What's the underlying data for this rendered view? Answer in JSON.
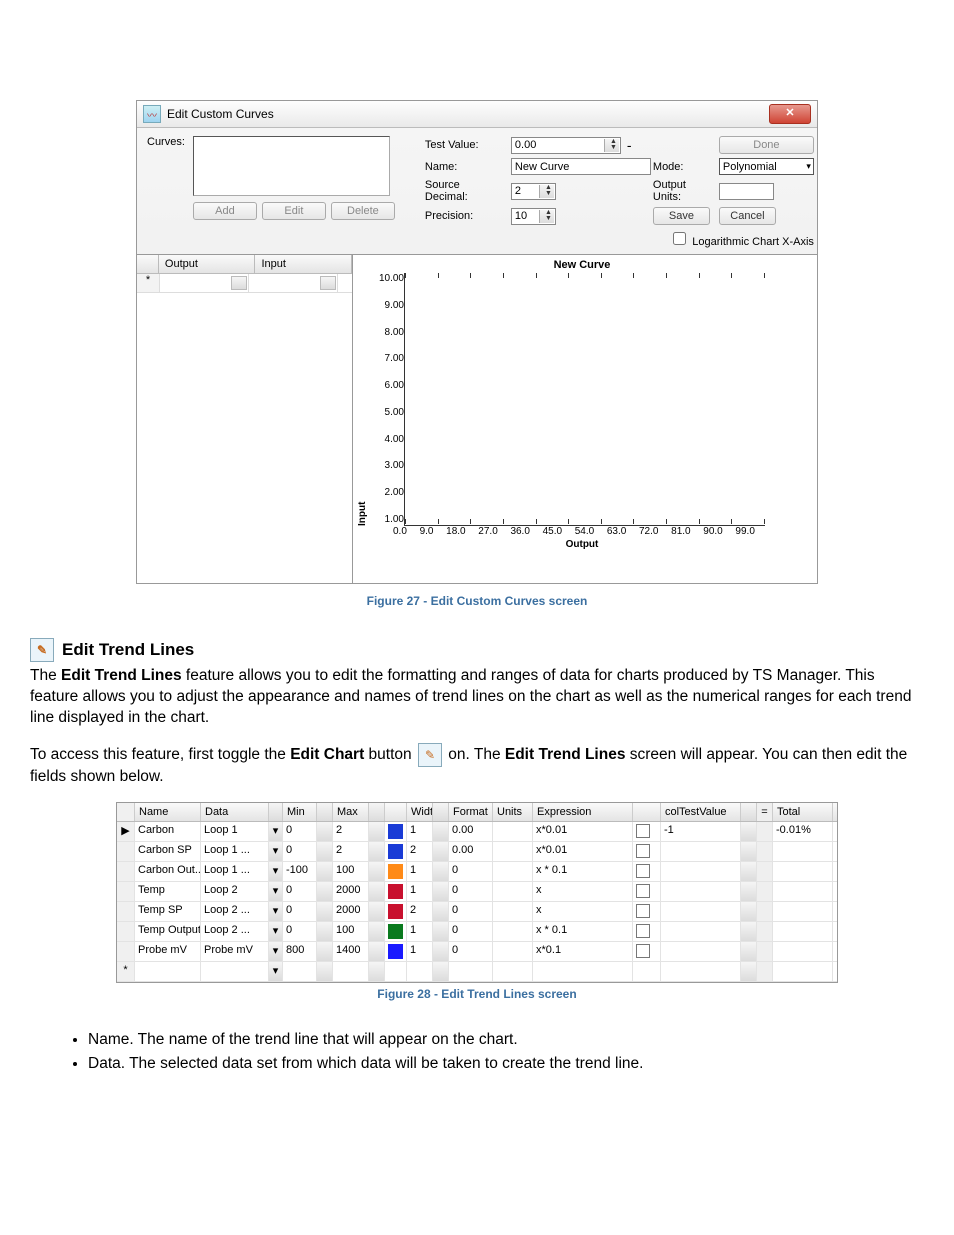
{
  "window": {
    "title": "Edit Custom Curves",
    "close": "✕",
    "labels": {
      "curves": "Curves:",
      "add": "Add",
      "edit": "Edit",
      "delete": "Delete",
      "testValue": "Test Value:",
      "testValueVal": "0.00",
      "done": "Done",
      "name": "Name:",
      "nameVal": "New Curve",
      "mode": "Mode:",
      "modeVal": "Polynomial",
      "sourceDecimal": "Source Decimal:",
      "sourceDecimalVal": "2",
      "outputUnits": "Output Units:",
      "precision": "Precision:",
      "precisionVal": "10",
      "save": "Save",
      "cancel": "Cancel",
      "logx": "Logarithmic Chart X-Axis"
    },
    "gridHeaders": {
      "output": "Output",
      "input": "Input"
    }
  },
  "chart_data": {
    "type": "line",
    "title": "New Curve",
    "xlabel": "Output",
    "ylabel": "Input",
    "xlim": [
      0.0,
      99.0
    ],
    "ylim": [
      1.0,
      10.0
    ],
    "yticks": [
      "10.00",
      "9.00",
      "8.00",
      "7.00",
      "6.00",
      "5.00",
      "4.00",
      "3.00",
      "2.00",
      "1.00"
    ],
    "xticks": [
      "0.0",
      "9.0",
      "18.0",
      "27.0",
      "36.0",
      "45.0",
      "54.0",
      "63.0",
      "72.0",
      "81.0",
      "90.0",
      "99.0"
    ],
    "series": []
  },
  "captions": {
    "fig27": "Figure 27 - Edit Custom Curves screen",
    "fig28": "Figure 28 - Edit Trend Lines screen"
  },
  "section": {
    "heading": "Edit Trend Lines",
    "para1a": "The ",
    "para1b": "Edit Trend Lines",
    "para1c": " feature allows you to edit the formatting and ranges of data for charts produced by TS Manager. This feature allows you to adjust the appearance and names of trend lines on the chart as well as the numerical ranges for each trend line displayed in the chart.",
    "para2a": "To access this feature, first toggle the ",
    "para2b": "Edit Chart",
    "para2c": " button ",
    "para2d": " on. The ",
    "para2e": "Edit Trend Lines",
    "para2f": " screen will appear. You can then edit the fields shown below."
  },
  "trend": {
    "headers": [
      "",
      "Name",
      "Data",
      "",
      "Min",
      "",
      "Max",
      "",
      "",
      "Width",
      "",
      "Format",
      "Units",
      "Expression",
      "",
      "colTestValue",
      "",
      "=",
      "Total"
    ],
    "rows": [
      {
        "name": "Carbon",
        "data": "Loop 1",
        "min": "0",
        "max": "2",
        "color": "#1a3bd6",
        "width": "1",
        "format": "0.00",
        "units": "",
        "expr": "x*0.01",
        "tv": "-1",
        "total": "-0.01%"
      },
      {
        "name": "Carbon SP",
        "data": "Loop 1 ...",
        "min": "0",
        "max": "2",
        "color": "#1a3bd6",
        "width": "2",
        "format": "0.00",
        "units": "",
        "expr": "x*0.01",
        "tv": "",
        "total": ""
      },
      {
        "name": "Carbon Out...",
        "data": "Loop 1 ...",
        "min": "-100",
        "max": "100",
        "color": "#ff8a17",
        "width": "1",
        "format": "0",
        "units": "",
        "expr": "x * 0.1",
        "tv": "",
        "total": ""
      },
      {
        "name": "Temp",
        "data": "Loop 2",
        "min": "0",
        "max": "2000",
        "color": "#c8102e",
        "width": "1",
        "format": "0",
        "units": "",
        "expr": "x",
        "tv": "",
        "total": ""
      },
      {
        "name": "Temp SP",
        "data": "Loop 2 ...",
        "min": "0",
        "max": "2000",
        "color": "#c8102e",
        "width": "2",
        "format": "0",
        "units": "",
        "expr": "x",
        "tv": "",
        "total": ""
      },
      {
        "name": "Temp Output",
        "data": "Loop 2 ...",
        "min": "0",
        "max": "100",
        "color": "#0a7a1e",
        "width": "1",
        "format": "0",
        "units": "",
        "expr": "x * 0.1",
        "tv": "",
        "total": ""
      },
      {
        "name": "Probe mV",
        "data": "Probe mV",
        "min": "800",
        "max": "1400",
        "color": "#1a1aff",
        "width": "1",
        "format": "0",
        "units": "",
        "expr": "x*0.1",
        "tv": "",
        "total": ""
      }
    ],
    "newRowStar": "*"
  },
  "bullets": {
    "b1": "Name. The name of the trend line that will appear on the chart.",
    "b2": "Data. The selected data set from which data will be taken to create the trend line."
  }
}
